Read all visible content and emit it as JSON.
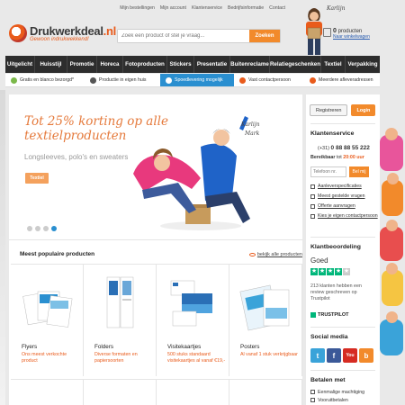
{
  "topnav": [
    "Mijn bestellingen",
    "Mijn account",
    "Klantenservice",
    "Bedrijfsinformatie",
    "Contact"
  ],
  "logo": {
    "name_part1": "Drukwerkdeal",
    "name_part2": ".nl",
    "tagline": "Gewoon indrukwekkend!"
  },
  "search": {
    "placeholder": "Zoek een product of stel je vraag...",
    "button": "Zoeken"
  },
  "mascot": {
    "name": "Karlijn"
  },
  "cart": {
    "count": "0",
    "label": "producten",
    "link": "Naar winkelwagen"
  },
  "mainnav": [
    "Uitgelicht",
    "Huisstijl",
    "Promotie",
    "Horeca",
    "Fotoproducten",
    "Stickers",
    "Presentatie",
    "Buitenreclame",
    "Relatiegeschenken",
    "Textiel",
    "Verpakking"
  ],
  "usp": [
    {
      "label": "Gratis en blanco bezorgd*",
      "active": false
    },
    {
      "label": "Productie in eigen huis",
      "active": false
    },
    {
      "label": "Spoedlevering mogelijk",
      "active": true
    },
    {
      "label": "Vast contactpersoon",
      "active": false
    },
    {
      "label": "Meerdere afleveradressen",
      "active": false
    }
  ],
  "hero": {
    "title": "Tot 25% korting op alle textielproducten",
    "subtitle": "Longsleeves, polo's en sweaters",
    "button": "Textiel",
    "note1": "Karlijn",
    "note2": "Mark",
    "slide_active": 4,
    "slide_count": 4
  },
  "popular": {
    "heading": "Meest populaire producten",
    "link": "bekijk alle producten"
  },
  "products": [
    {
      "name": "Flyers",
      "desc": "Ons meest verkochte product"
    },
    {
      "name": "Folders",
      "desc": "Diverse formaten en papiersoorten"
    },
    {
      "name": "Visitekaartjes",
      "desc": "500 stuks standaard visitekaartjes al vanaf €19,-"
    },
    {
      "name": "Posters",
      "desc": "Al vanaf 1 stuk verkrijgbaar"
    }
  ],
  "sidebar": {
    "register": "Registreren",
    "login": "Login",
    "service_title": "Klantenservice",
    "phone_prefix": "(+31)",
    "phone": "0 88 88 55 222",
    "reach_label": "Bereikbaar",
    "reach_mid": "tot",
    "reach_time": "20:00 uur",
    "tel_placeholder": "Telefoon nr.",
    "tel_button": "Bel mij",
    "links": [
      "Aanleverspecificaties",
      "Meest gestelde vragen",
      "Offerte aanvragen",
      "Kies je eigen contactpersoon"
    ],
    "rating_title": "Klantbeoordeling",
    "rating_word": "Goed",
    "stars_filled": 4,
    "stars_total": 5,
    "review_text": "213 klanten hebben een review geschreven op Trustpilot",
    "trustpilot": "TRUSTPILOT",
    "social_title": "Social media",
    "social": [
      {
        "name": "twitter",
        "glyph": "t",
        "color": "#3aa3d9"
      },
      {
        "name": "facebook",
        "glyph": "f",
        "color": "#3b5998"
      },
      {
        "name": "youtube",
        "glyph": "You",
        "color": "#d62b22"
      },
      {
        "name": "blog",
        "glyph": "b",
        "color": "#f28a2b"
      }
    ],
    "pay_title": "Betalen met",
    "pay": [
      "Eenmalige machtiging",
      "Vooruitbetalen"
    ]
  },
  "colors": {
    "accent": "#f28a2b",
    "nav": "#2d2d2d",
    "link": "#2a8fd0"
  }
}
